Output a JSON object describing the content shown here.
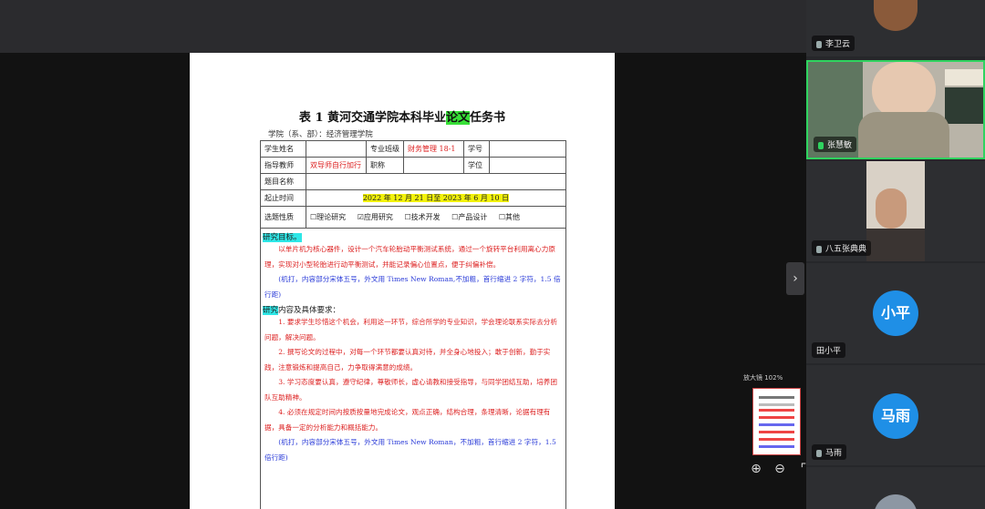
{
  "document": {
    "title_prefix": "表 1 黄河交通学院本科毕业",
    "title_highlight": "论文",
    "title_suffix": "任务书",
    "college": "学院（系、部）：经济管理学院",
    "table": {
      "student_name_label": "学生姓名",
      "major_class_label": "专业班级",
      "major_class_value": "财务管理 18-1",
      "student_id_label": "学号",
      "advisor_label": "指导教师",
      "advisor_value": "双导师自行加行",
      "title_rank_label": "职称",
      "degree_label": "学位",
      "topic_label": "题目名称",
      "period_label": "起止时间",
      "period_value": "2022 年 12 月 21 日至 2023 年 6 月 10 日",
      "topic_type_label": "选题性质",
      "topic_types": [
        "☐理论研究",
        "☑应用研究",
        "☐技术开发",
        "☐产品设计",
        "☐其他"
      ]
    },
    "section1_head_highlight": "研究目标。",
    "section1_para": "以单片机为核心器件，设计一个汽车轮胎动平衡测试系统，通过一个旋转平台利用离心力原理，实现对小型轮胎进行动平衡测试，并能记录偏心位置点，便于纠偏补偿。",
    "section1_note": "(机打，内容部分宋体五号，外文用 Times New Roman,不加粗，首行缩进 2 字符，1.5 倍行距)",
    "section2_head_highlight": "研究",
    "section2_head_rest": "内容及具体要求：",
    "section2_items": [
      "1. 要求学生珍惜这个机会，利用这一环节，综合所学的专业知识，学会理论联系实际去分析问题，解决问题。",
      "2. 撰写论文的过程中，对每一个环节都要认真对待，并全身心地投入；敢于创新，勤于实践，注意锻炼和提高自己，力争取得满意的成绩。",
      "3. 学习态度要认真，遵守纪律，尊敬师长，虚心请教和接受指导，与同学团结互助，培养团队互助精神。",
      "4. 必须在规定时间内按质按量地完成论文，观点正确，结构合理，条理清晰，论据有理有据，具备一定的分析能力和概括能力。"
    ],
    "section2_note": "(机打，内容部分宋体五号，外文用 Times New Roman，不加粗，首行缩进 2 字符，1.5 倍行距)"
  },
  "viewer": {
    "zoom_label": "放大镜 102%",
    "zoom_in_icon": "⊕",
    "zoom_out_icon": "⊖",
    "expand_icon": "⌜",
    "collapse_arrow": "›"
  },
  "participants": [
    {
      "name": "李卫云",
      "type": "video"
    },
    {
      "name": "张慧敏",
      "type": "video",
      "active": true
    },
    {
      "name": "八五张典典",
      "type": "video"
    },
    {
      "name": "田小平",
      "type": "avatar",
      "initials": "小平"
    },
    {
      "name": "马雨",
      "type": "avatar",
      "initials": "马雨"
    }
  ],
  "colors": {
    "accent_green": "#2fd35f",
    "avatar_blue": "#1f8fe6",
    "highlight_yellow": "#f2f20a",
    "highlight_cyan": "#2ee7e7",
    "text_red": "#d22222",
    "text_blue": "#2a3bd8"
  }
}
